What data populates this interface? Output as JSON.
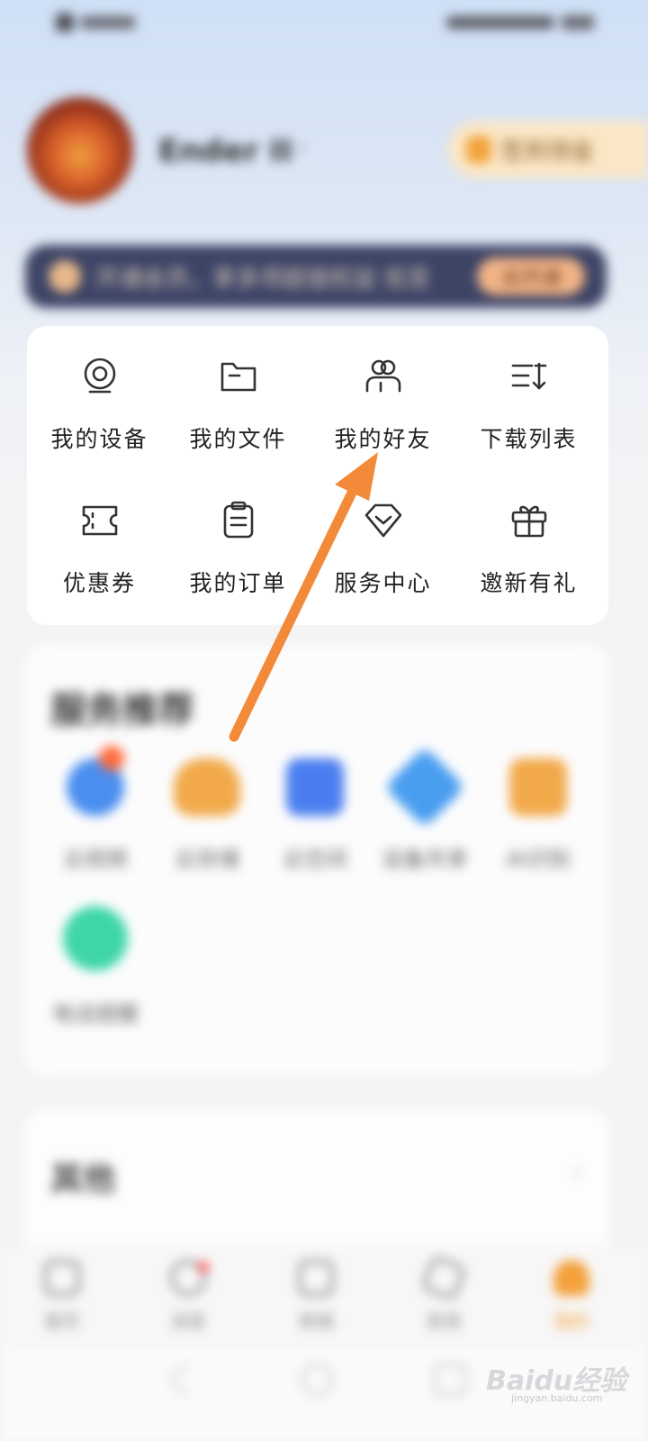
{
  "profile": {
    "username": "Ender II",
    "sign_in_label": "签到领金"
  },
  "vip_banner": {
    "text": "开通会员，享多项超值权益 低至",
    "button_label": "去开通"
  },
  "menu": {
    "items": [
      {
        "label": "我的设备",
        "icon": "camera-icon"
      },
      {
        "label": "我的文件",
        "icon": "folder-icon"
      },
      {
        "label": "我的好友",
        "icon": "friends-icon"
      },
      {
        "label": "下载列表",
        "icon": "download-list-icon"
      },
      {
        "label": "优惠券",
        "icon": "coupon-icon"
      },
      {
        "label": "我的订单",
        "icon": "order-clipboard-icon"
      },
      {
        "label": "服务中心",
        "icon": "service-heart-icon"
      },
      {
        "label": "邀新有礼",
        "icon": "gift-icon"
      }
    ]
  },
  "recommend": {
    "title": "服务推荐",
    "items": [
      {
        "label": "云视频",
        "color": "#4a8ef0"
      },
      {
        "label": "云存储",
        "color": "#f2a94a"
      },
      {
        "label": "云空间",
        "color": "#4a7ef0"
      },
      {
        "label": "设备共享",
        "color": "#4a9ef0"
      },
      {
        "label": "AI识别",
        "color": "#f2a94a"
      },
      {
        "label": "电话提醒",
        "color": "#3ed6a8"
      }
    ]
  },
  "other": {
    "title": "其他"
  },
  "bottom_nav": {
    "items": [
      {
        "label": "首页",
        "active": false
      },
      {
        "label": "消息",
        "active": false
      },
      {
        "label": "商城",
        "active": false
      },
      {
        "label": "发现",
        "active": false
      },
      {
        "label": "我的",
        "active": true
      }
    ]
  },
  "watermark": {
    "text": "Baidu经验",
    "sub": "jingyan.baidu.com"
  },
  "colors": {
    "accent": "#f4a13b",
    "arrow": "#f28a3a",
    "vip_banner_bg": "#3d4466"
  }
}
